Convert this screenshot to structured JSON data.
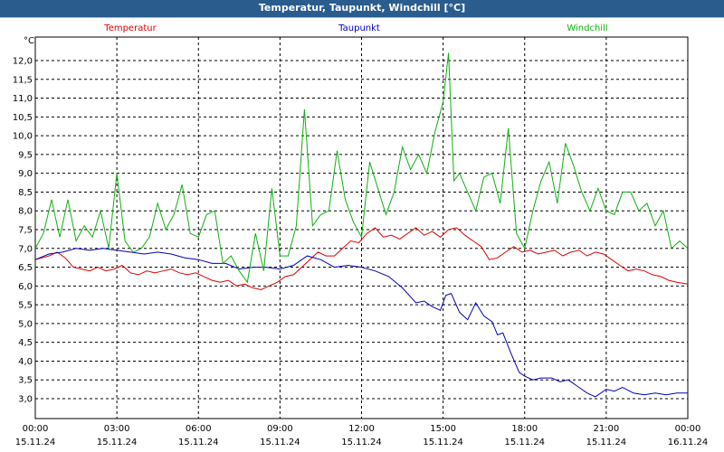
{
  "window": {
    "title": "Temperatur, Taupunkt, Windchill [°C]"
  },
  "chart_data": {
    "type": "line",
    "title": "Temperatur, Taupunkt, Windchill [°C]",
    "ylabel": "°C",
    "ylim": [
      2.5,
      12.5
    ],
    "xlim": [
      0,
      24
    ],
    "grid": true,
    "legend_position": "top",
    "y_ticks": [
      "3,0",
      "3,5",
      "4,0",
      "4,5",
      "5,0",
      "5,5",
      "6,0",
      "6,5",
      "7,0",
      "7,5",
      "8,0",
      "8,5",
      "9,0",
      "9,5",
      "10,0",
      "10,5",
      "11,0",
      "11,5",
      "12,0"
    ],
    "x_ticks": [
      {
        "time": "00:00",
        "date": "15.11.24"
      },
      {
        "time": "03:00",
        "date": "15.11.24"
      },
      {
        "time": "06:00",
        "date": "15.11.24"
      },
      {
        "time": "09:00",
        "date": "15.11.24"
      },
      {
        "time": "12:00",
        "date": "15.11.24"
      },
      {
        "time": "15:00",
        "date": "15.11.24"
      },
      {
        "time": "18:00",
        "date": "15.11.24"
      },
      {
        "time": "21:00",
        "date": "15.11.24"
      },
      {
        "time": "00:00",
        "date": "16.11.24"
      }
    ],
    "series": [
      {
        "name": "Temperatur",
        "color": "#e00000",
        "x": [
          0,
          0.5,
          0.8,
          1.1,
          1.4,
          1.7,
          2,
          2.3,
          2.6,
          2.9,
          3.2,
          3.5,
          3.8,
          4.1,
          4.4,
          4.7,
          5,
          5.3,
          5.6,
          5.9,
          6.2,
          6.5,
          6.8,
          7.1,
          7.4,
          7.7,
          8,
          8.3,
          8.6,
          8.9,
          9.2,
          9.5,
          9.8,
          10.1,
          10.4,
          10.7,
          11,
          11.3,
          11.6,
          11.9,
          12.2,
          12.5,
          12.8,
          13.1,
          13.4,
          13.7,
          14,
          14.3,
          14.6,
          14.9,
          15.2,
          15.5,
          15.8,
          16.1,
          16.4,
          16.7,
          17,
          17.3,
          17.6,
          17.9,
          18.2,
          18.5,
          18.8,
          19.1,
          19.4,
          19.7,
          20,
          20.3,
          20.6,
          20.9,
          21.2,
          21.5,
          21.8,
          22.1,
          22.4,
          22.7,
          23,
          23.3,
          23.6,
          24
        ],
        "y": [
          6.7,
          6.8,
          6.9,
          6.75,
          6.5,
          6.45,
          6.4,
          6.5,
          6.4,
          6.45,
          6.55,
          6.35,
          6.3,
          6.4,
          6.35,
          6.4,
          6.45,
          6.35,
          6.3,
          6.35,
          6.25,
          6.15,
          6.1,
          6.15,
          6.0,
          6.05,
          5.95,
          5.9,
          6.0,
          6.1,
          6.25,
          6.3,
          6.5,
          6.7,
          6.9,
          6.8,
          6.8,
          7.0,
          7.2,
          7.15,
          7.4,
          7.55,
          7.3,
          7.35,
          7.25,
          7.4,
          7.55,
          7.35,
          7.45,
          7.3,
          7.5,
          7.55,
          7.35,
          7.2,
          7.05,
          6.7,
          6.75,
          6.9,
          7.05,
          6.9,
          6.95,
          6.85,
          6.9,
          6.95,
          6.8,
          6.9,
          6.95,
          6.8,
          6.9,
          6.85,
          6.7,
          6.55,
          6.4,
          6.45,
          6.4,
          6.3,
          6.25,
          6.15,
          6.1,
          6.05
        ]
      },
      {
        "name": "Taupunkt",
        "color": "#0000c0",
        "x": [
          0,
          0.5,
          1,
          1.5,
          2,
          2.5,
          3,
          3.5,
          4,
          4.5,
          5,
          5.5,
          6,
          6.5,
          7,
          7.5,
          8,
          8.5,
          9,
          9.5,
          10,
          10.5,
          11,
          11.5,
          12,
          12.5,
          13,
          13.5,
          14,
          14.3,
          14.6,
          14.9,
          15.1,
          15.3,
          15.6,
          15.9,
          16.2,
          16.5,
          16.8,
          17,
          17.2,
          17.5,
          17.8,
          18,
          18.3,
          18.6,
          19,
          19.3,
          19.6,
          20,
          20.3,
          20.6,
          21,
          21.3,
          21.6,
          22,
          22.4,
          22.8,
          23.2,
          23.6,
          24
        ],
        "y": [
          6.7,
          6.85,
          6.9,
          7.0,
          6.95,
          7.0,
          6.95,
          6.9,
          6.85,
          6.9,
          6.85,
          6.75,
          6.7,
          6.6,
          6.6,
          6.45,
          6.5,
          6.5,
          6.45,
          6.55,
          6.8,
          6.7,
          6.5,
          6.55,
          6.5,
          6.4,
          6.25,
          5.95,
          5.55,
          5.6,
          5.45,
          5.35,
          5.75,
          5.8,
          5.3,
          5.1,
          5.55,
          5.2,
          5.05,
          4.7,
          4.75,
          4.2,
          3.7,
          3.6,
          3.5,
          3.55,
          3.55,
          3.45,
          3.5,
          3.3,
          3.15,
          3.05,
          3.25,
          3.2,
          3.3,
          3.15,
          3.1,
          3.15,
          3.1,
          3.15,
          3.15
        ]
      },
      {
        "name": "Windchill",
        "color": "#10b010",
        "x": [
          0,
          0.3,
          0.6,
          0.9,
          1.2,
          1.5,
          1.8,
          2.1,
          2.4,
          2.7,
          3,
          3.3,
          3.6,
          3.9,
          4.2,
          4.5,
          4.8,
          5.1,
          5.4,
          5.7,
          6,
          6.3,
          6.6,
          6.9,
          7.2,
          7.5,
          7.8,
          8.1,
          8.4,
          8.7,
          9,
          9.3,
          9.6,
          9.9,
          10.2,
          10.5,
          10.8,
          11.1,
          11.4,
          11.7,
          12,
          12.3,
          12.6,
          12.9,
          13.2,
          13.5,
          13.8,
          14.1,
          14.4,
          14.7,
          15,
          15.2,
          15.4,
          15.6,
          15.9,
          16.2,
          16.5,
          16.8,
          17.1,
          17.4,
          17.7,
          18,
          18.3,
          18.6,
          18.9,
          19.2,
          19.5,
          19.8,
          20.1,
          20.4,
          20.7,
          21,
          21.3,
          21.6,
          21.9,
          22.2,
          22.5,
          22.8,
          23.1,
          23.4,
          23.7,
          24
        ],
        "y": [
          7.0,
          7.4,
          8.3,
          7.3,
          8.3,
          7.2,
          7.6,
          7.3,
          8.0,
          7.0,
          9.0,
          7.2,
          6.9,
          7.0,
          7.3,
          8.2,
          7.5,
          7.9,
          8.7,
          7.4,
          7.3,
          7.9,
          8.0,
          6.6,
          6.8,
          6.4,
          6.1,
          7.4,
          6.4,
          8.6,
          6.8,
          6.8,
          7.6,
          10.7,
          7.6,
          7.9,
          8.0,
          9.6,
          8.3,
          7.7,
          7.3,
          9.3,
          8.6,
          7.9,
          8.5,
          9.7,
          9.1,
          9.5,
          9.0,
          10.1,
          10.9,
          12.2,
          8.8,
          9.0,
          8.5,
          8.0,
          8.9,
          9.0,
          8.2,
          10.2,
          7.4,
          7.0,
          8.0,
          8.8,
          9.3,
          8.2,
          9.8,
          9.2,
          8.5,
          8.0,
          8.6,
          8.0,
          7.9,
          8.5,
          8.5,
          8.0,
          8.2,
          7.6,
          8.0,
          7.0,
          7.2,
          7.0
        ]
      }
    ]
  }
}
